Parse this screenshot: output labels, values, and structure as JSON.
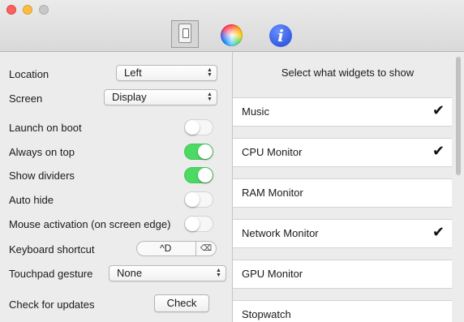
{
  "toolbar": {
    "tabs": [
      {
        "name": "general",
        "icon": "switch-icon"
      },
      {
        "name": "appearance",
        "icon": "color-wheel-icon"
      },
      {
        "name": "about",
        "icon": "info-icon",
        "glyph": "i"
      }
    ]
  },
  "settings": {
    "location": {
      "label": "Location",
      "value": "Left"
    },
    "screen": {
      "label": "Screen",
      "value": "Display"
    },
    "launch_on_boot": {
      "label": "Launch on boot",
      "on": false
    },
    "always_on_top": {
      "label": "Always on top",
      "on": true
    },
    "show_dividers": {
      "label": "Show dividers",
      "on": true
    },
    "auto_hide": {
      "label": "Auto hide",
      "on": false
    },
    "mouse_activation": {
      "label": "Mouse activation (on screen edge)",
      "on": false
    },
    "keyboard_shortcut": {
      "label": "Keyboard shortcut",
      "value": "^D",
      "clear_glyph": "⌫"
    },
    "touchpad_gesture": {
      "label": "Touchpad gesture",
      "value": "None"
    },
    "check_updates": {
      "label": "Check for updates",
      "button": "Check"
    }
  },
  "widgets": {
    "title": "Select what widgets to show",
    "check_glyph": "✔",
    "items": [
      {
        "name": "Music",
        "checked": true
      },
      {
        "name": "CPU Monitor",
        "checked": true
      },
      {
        "name": "RAM Monitor",
        "checked": false
      },
      {
        "name": "Network Monitor",
        "checked": true
      },
      {
        "name": "GPU Monitor",
        "checked": false
      },
      {
        "name": "Stopwatch",
        "checked": false
      }
    ]
  },
  "colors": {
    "toggle_on": "#4cd964",
    "info_blue": "#1f48d6"
  }
}
